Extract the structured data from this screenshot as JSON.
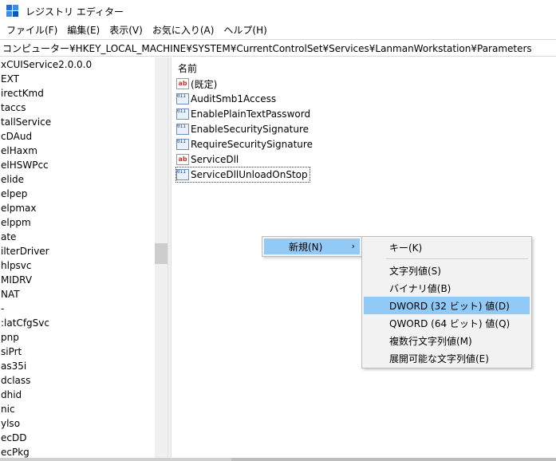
{
  "window": {
    "title": "レジストリ エディター"
  },
  "menubar": {
    "items": [
      "ファイル(F)",
      "編集(E)",
      "表示(V)",
      "お気に入り(A)",
      "ヘルプ(H)"
    ]
  },
  "address": {
    "path": "コンピューター¥HKEY_LOCAL_MACHINE¥SYSTEM¥CurrentControlSet¥Services¥LanmanWorkstation¥Parameters"
  },
  "tree": {
    "items": [
      "xCUIService2.0.0.0",
      "EXT",
      "irectKmd",
      "taccs",
      "tallService",
      "cDAud",
      "elHaxm",
      "elHSWPcc",
      "elide",
      "elpep",
      "elpmax",
      "elppm",
      "ate",
      "ilterDriver",
      "hlpsvc",
      "MIDRV",
      "NAT",
      "-",
      ":latCfgSvc",
      "pnp",
      "siPrt",
      "as35i",
      "dclass",
      "dhid",
      "nic",
      "ylso",
      "ecDD",
      "ecPkg"
    ]
  },
  "list": {
    "column_name": "名前",
    "values": [
      {
        "type": "string",
        "icon": "ab",
        "name": "(既定)"
      },
      {
        "type": "binary",
        "icon": "bin",
        "name": "AuditSmb1Access"
      },
      {
        "type": "binary",
        "icon": "bin",
        "name": "EnablePlainTextPassword"
      },
      {
        "type": "binary",
        "icon": "bin",
        "name": "EnableSecuritySignature"
      },
      {
        "type": "binary",
        "icon": "bin",
        "name": "RequireSecuritySignature"
      },
      {
        "type": "string",
        "icon": "ab",
        "name": "ServiceDll"
      },
      {
        "type": "binary",
        "icon": "bin",
        "name": "ServiceDllUnloadOnStop"
      }
    ]
  },
  "icons": {
    "string_glyph": "ab",
    "binary_glyph": "011 110"
  },
  "context_menu": {
    "new_label": "新規(N)",
    "arrow": "›"
  },
  "submenu": {
    "key": "キー(K)",
    "string": "文字列値(S)",
    "binary": "バイナリ値(B)",
    "dword": "DWORD (32 ビット) 値(D)",
    "qword": "QWORD (64 ビット) 値(Q)",
    "multi_string": "複数行文字列値(M)",
    "expandable_string": "展開可能な文字列値(E)"
  },
  "colors": {
    "highlight": "#91c9f7",
    "menu_bg": "#f2f2f2"
  }
}
